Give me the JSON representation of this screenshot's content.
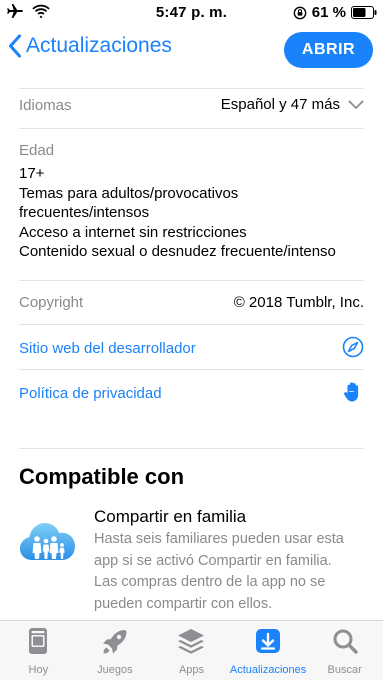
{
  "status_bar": {
    "time": "5:47 p. m.",
    "battery": "61 %",
    "icons": [
      "airplane-icon",
      "wifi-icon",
      "orientation-lock-icon",
      "battery-icon"
    ]
  },
  "nav": {
    "back_label": "Actualizaciones",
    "open_label": "ABRIR",
    "accent_color": "#1a82fb"
  },
  "info": {
    "languages_label": "Idiomas",
    "languages_value": "Español y 47 más",
    "age_label": "Edad",
    "age_lines": [
      "17+",
      "Temas para adultos/provocativos",
      "frecuentes/intensos",
      "Acceso a internet sin restricciones",
      "Contenido sexual o desnudez frecuente/intenso"
    ],
    "copyright_label": "Copyright",
    "copyright_value": "© 2018 Tumblr, Inc.",
    "developer_link": "Sitio web del desarrollador",
    "privacy_link": "Política de privacidad"
  },
  "compatible": {
    "title": "Compatible con",
    "family_title": "Compartir en familia",
    "family_desc_lines": [
      "Hasta seis familiares pueden usar esta",
      "app si se activó Compartir en familia.",
      "Las compras dentro de la app no se",
      "pueden compartir con ellos."
    ]
  },
  "tabs": [
    {
      "label": "Hoy",
      "icon": "today-icon"
    },
    {
      "label": "Juegos",
      "icon": "rocket-icon"
    },
    {
      "label": "Apps",
      "icon": "apps-stack-icon"
    },
    {
      "label": "Actualizaciones",
      "icon": "updates-download-icon",
      "active": true
    },
    {
      "label": "Buscar",
      "icon": "search-icon"
    }
  ]
}
